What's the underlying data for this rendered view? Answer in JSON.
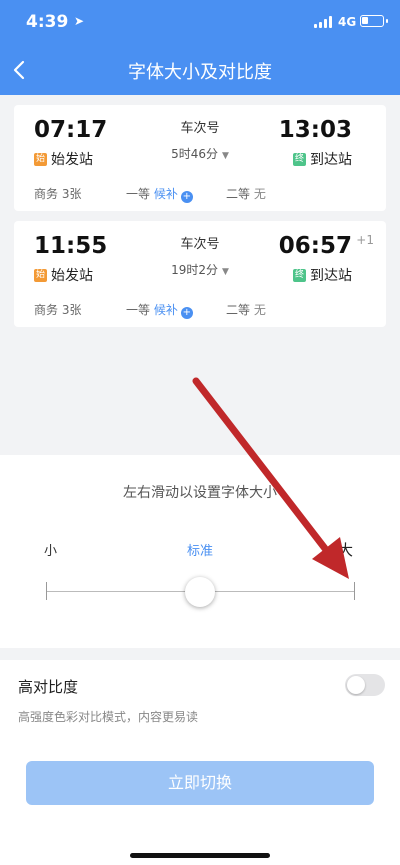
{
  "status": {
    "time": "4:39",
    "network": "4G",
    "battery_level": 0.3
  },
  "nav": {
    "title": "字体大小及对比度"
  },
  "trains": [
    {
      "depart_time": "07:17",
      "arrive_time": "13:03",
      "train_no": "车次号",
      "duration": "5时46分",
      "depart_tag": "始",
      "depart_station": "始发站",
      "arrive_tag": "终",
      "arrive_station": "到达站",
      "day_offset": "",
      "seat_business": "商务 3张",
      "seat_first_label": "一等",
      "seat_first_status": "候补",
      "seat_second_label": "二等",
      "seat_second_status": "无"
    },
    {
      "depart_time": "11:55",
      "arrive_time": "06:57",
      "train_no": "车次号",
      "duration": "19时2分",
      "depart_tag": "始",
      "depart_station": "始发站",
      "arrive_tag": "终",
      "arrive_station": "到达站",
      "day_offset": "+1",
      "seat_business": "商务 3张",
      "seat_first_label": "一等",
      "seat_first_status": "候补",
      "seat_second_label": "二等",
      "seat_second_status": "无"
    }
  ],
  "slider": {
    "hint": "左右滑动以设置字体大小",
    "label_small": "小",
    "label_standard": "标准",
    "label_large": "大",
    "position": 0.5
  },
  "contrast": {
    "title": "高对比度",
    "description": "高强度色彩对比模式，内容更易读",
    "enabled": false
  },
  "apply_button": "立即切换",
  "colors": {
    "header": "#4a90f2",
    "accent": "#4a90f2",
    "button_disabled": "#9cc4f6",
    "annotation_arrow": "#c0282a"
  },
  "icons": {
    "back": "chevron-left-icon",
    "location": "location-arrow-icon",
    "waitlist": "plus-circle-icon",
    "dropdown": "caret-down-icon"
  }
}
